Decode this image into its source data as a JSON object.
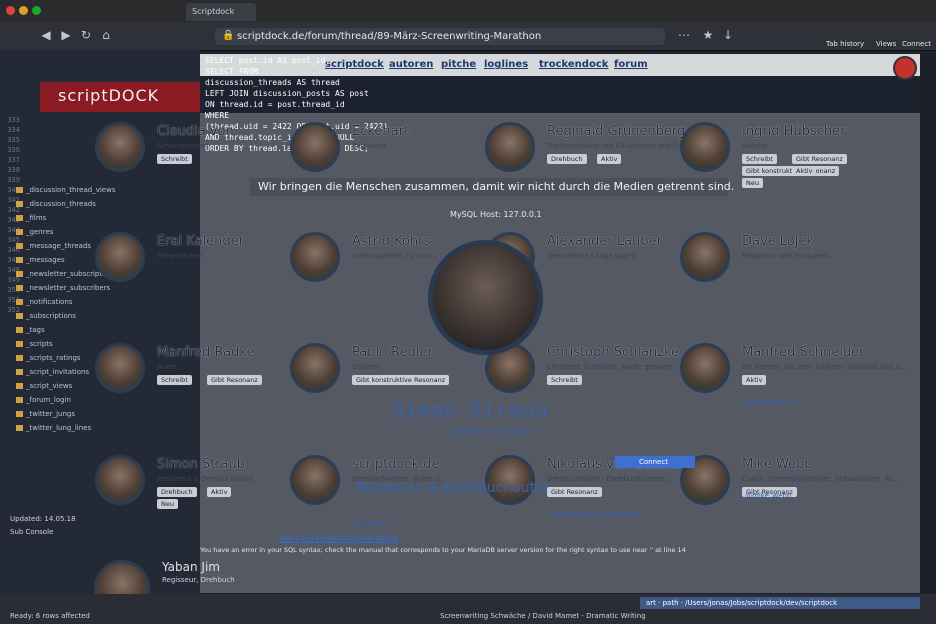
{
  "browser": {
    "tab_title": "Scriptdock",
    "url": "scriptdock.de/forum/thread/89-März-Screenwriting-Marathon",
    "right_labels": [
      "Tab history",
      "Views",
      "Connect"
    ]
  },
  "editor": {
    "line_numbers": [
      "333",
      "334",
      "335",
      "336",
      "337",
      "338",
      "339",
      "340",
      "341",
      "342",
      "343",
      "344",
      "345",
      "346",
      "347",
      "348",
      "349",
      "350",
      "351",
      "352"
    ],
    "tree": [
      "_discussion_thread_views",
      "_discussion_threads",
      "_films",
      "_genres",
      "_message_threads",
      "_messages",
      "_newsletter_subscriptions",
      "_newsletter_subscribers",
      "_notifications",
      "_subscriptions",
      "_tags",
      "_scripts",
      "_scripts_ratings",
      "_script_invitations",
      "_script_views",
      "_forum_login",
      "_twitter_jungs",
      "_twitter_lung_lines"
    ],
    "panel_label": "Sub Console",
    "updated": "Updated: 14.05.18"
  },
  "sql": {
    "lines": [
      "SELECT post.id AS post_id,",
      "SELECT     FROM",
      "    discussion_threads AS thread",
      "LEFT JOIN discussion_posts AS post",
      "ON thread.id = post.thread_id",
      "WHERE",
      "    (thread.uid = 2422 OR post.uid = 2422)",
      "    AND thread.topic_id IS NOT NULL",
      "ORDER BY thread.lastPostDate DESC;"
    ],
    "mysql_host": "MySQL Host: 127.0.0.1"
  },
  "site": {
    "logo": "scriptDOCK",
    "nav": [
      "scriptdock",
      "autoren",
      "pitche",
      "loglines",
      "trockendock",
      "forum"
    ],
    "info_banner": "Wir bringen die Menschen zusammen, damit wir nicht durch die Medien getrennt sind.",
    "connect_label": "Connect",
    "error_text": "You have an error in your SQL syntax; check the manual that corresponds to your MariaDB server version for the right syntax to use near '' at line 14",
    "marathon_link": "März-Screenwriting-Marathon"
  },
  "profiles": [
    {
      "name": "Claudia von",
      "desc": "Schauspielerin",
      "buttons": [
        "Schreibt"
      ]
    },
    {
      "name": "Eckehart",
      "desc": "Regisseur",
      "buttons": []
    },
    {
      "name": "Reginald Grünenberg",
      "desc": "Drehbuchautor mit Co-Autoren und Co-Produ...",
      "buttons": [
        "Drehbuch",
        "Aktiv"
      ]
    },
    {
      "name": "Ingrid Hübscher",
      "desc": "Autorin",
      "buttons": [
        "Schreibt",
        "Gibt Resonanz",
        "Gibt konstruktive Resonanz",
        "Aktiv",
        "Neu"
      ]
    },
    {
      "name": "Eral Kalender",
      "desc": "Filmemacher",
      "buttons": []
    },
    {
      "name": "Astrid Kohrs",
      "desc": "Schauspielerin,TV und ...",
      "buttons": []
    },
    {
      "name": "Alexander Lauber",
      "desc": "Vermutliche Länge sagen",
      "buttons": []
    },
    {
      "name": "Dave Lojek",
      "desc": "Regisseur und Produzent.",
      "buttons": []
    },
    {
      "name": "Manfred Radke",
      "desc": "Autor",
      "buttons": [
        "Schreibt",
        "Gibt Resonanz"
      ]
    },
    {
      "name": "Pablo Redler",
      "desc": "Student",
      "buttons": [
        "Gibt konstruktive Resonanz"
      ]
    },
    {
      "name": "Christoph Schlanzke",
      "desc": "Christoph Schlanzke wurde geboren",
      "buttons": [
        "Schreibt"
      ]
    },
    {
      "name": "Manfred Schneider",
      "desc": "Ich komme aus dem schönen Saarland und b...",
      "buttons": [
        "Aktiv"
      ]
    },
    {
      "name": "Simon Straub",
      "desc": "Regisseur & Drehbuchautor",
      "buttons": [
        "Drehbuch",
        "Aktiv",
        "Neu"
      ]
    },
    {
      "name": "scriptdock.de",
      "desc": "Drehbuchwärter, putze d...",
      "buttons": []
    },
    {
      "name": "Nikolaus von Uthmann",
      "desc": "Drehbuchautor - Drehbuchüberse...",
      "buttons": [
        "Gibt Resonanz"
      ]
    },
    {
      "name": "Mike Webb",
      "desc": "Coach, Screenplaytrainer, Schauspieler, Re...",
      "buttons": [
        "Gibt Resonanz"
      ]
    }
  ],
  "profile_handles": [
    "@ischeer",
    "@nikolaus_von_uthmann",
    "@mike_webb",
    "@manfred_sch"
  ],
  "featured": {
    "name": "Simon Straub",
    "handle": "@Simon_Straub",
    "subtitle": "Regisseur & Drehbuchautor"
  },
  "extra_user": {
    "name": "Yaban Jim",
    "desc": "Regisseur, Drehbuch"
  },
  "terminal": {
    "path": "art · path · /Users/jonas/Jobs/scriptdock/dev/scriptdock",
    "status": "Ready: 6 rows affected",
    "footer": "Screenwriting Schwäche / David Mamet - Dramatic Writing"
  }
}
